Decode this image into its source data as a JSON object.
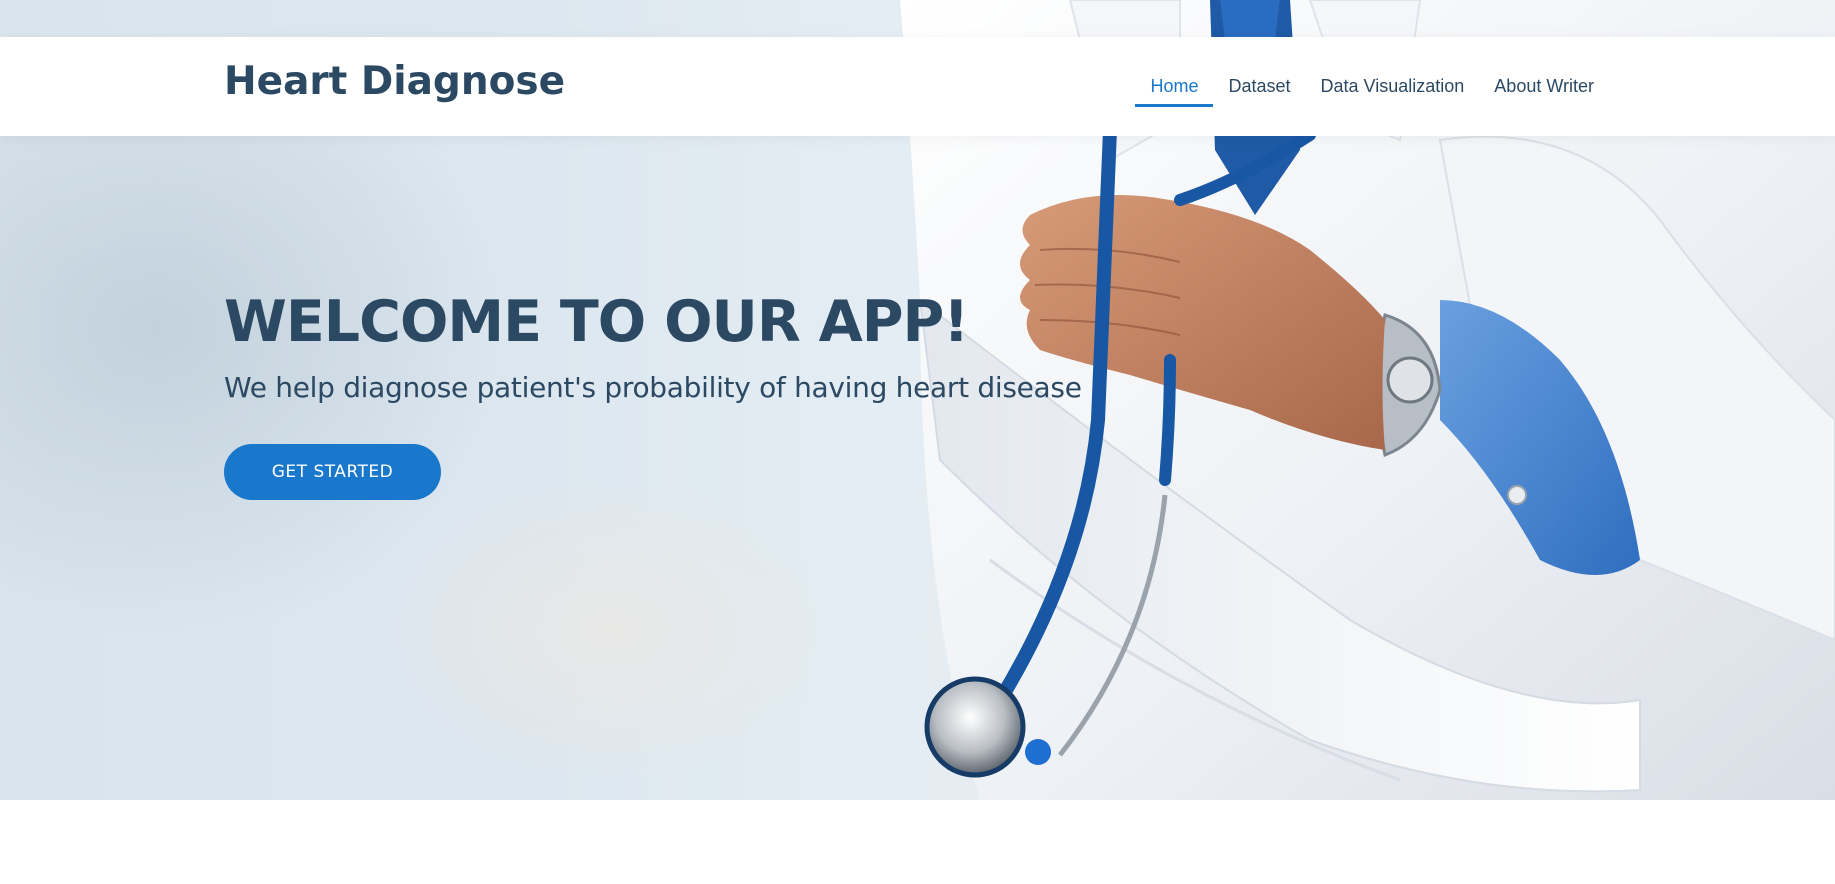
{
  "header": {
    "logo": "Heart Diagnose",
    "nav": [
      {
        "label": "Home",
        "active": true
      },
      {
        "label": "Dataset",
        "active": false
      },
      {
        "label": "Data Visualization",
        "active": false
      },
      {
        "label": "About Writer",
        "active": false
      }
    ]
  },
  "hero": {
    "title": "WELCOME TO OUR APP!",
    "subtitle": "We help diagnose patient's probability of having heart disease",
    "cta_label": "GET STARTED",
    "illustration": "doctor-with-stethoscope"
  },
  "colors": {
    "brand": "#2c4964",
    "accent": "#1977cc"
  }
}
